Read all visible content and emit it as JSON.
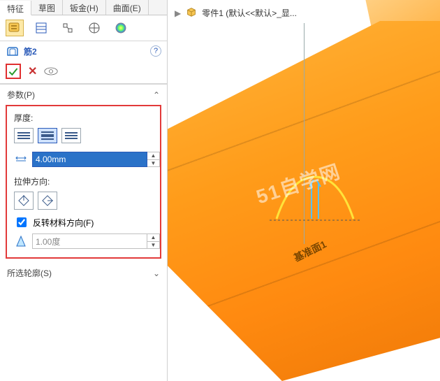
{
  "tabs": {
    "t0": "特征",
    "t1": "草图",
    "t2": "钣金(H)",
    "t3": "曲面(E)"
  },
  "feature": {
    "title": "筋2",
    "help": "?"
  },
  "sections": {
    "params_label": "参数(P)",
    "thickness_label": "厚度:",
    "extrude_dir_label": "拉伸方向:",
    "flip_label": "反转材料方向(F)",
    "contour_label": "所选轮廓(S)"
  },
  "fields": {
    "thickness_value": "4.00mm",
    "draft_value": "1.00度"
  },
  "crumb": {
    "part_label": "零件1  (默认<<默认>_显..."
  },
  "viewport": {
    "watermark": "51自学网",
    "base_plane_label": "基准面1"
  },
  "icons": {
    "feature_tree": "feature-tree",
    "property": "property-manager",
    "config": "configuration",
    "appearance": "appearance",
    "display": "display-state",
    "rib": "rib",
    "ok": "ok",
    "cancel": "cancel",
    "eye": "preview",
    "draft": "draft"
  },
  "colors": {
    "highlight_border": "#e23a3a",
    "accent": "#2a5ab8",
    "part": "#ff9c1a"
  }
}
